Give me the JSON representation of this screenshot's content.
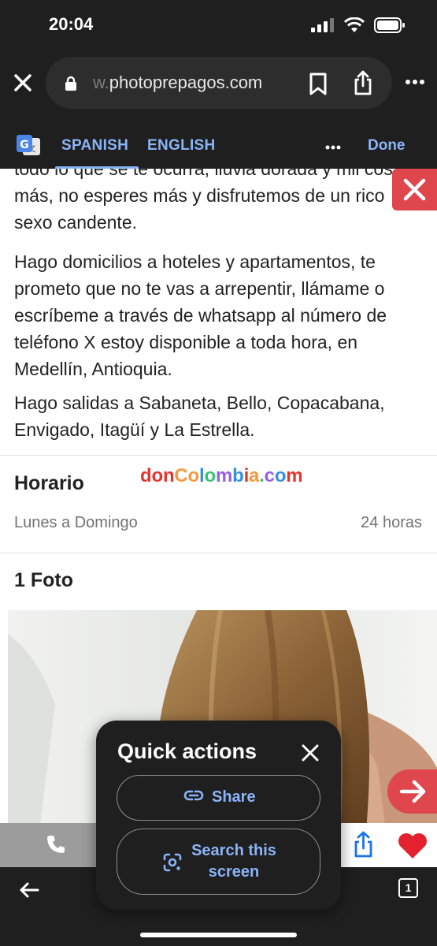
{
  "status_bar": {
    "time": "20:04"
  },
  "browser": {
    "url_prefix": "w.",
    "url_domain": "photoprepagos.com"
  },
  "translate_bar": {
    "languages": [
      "SPANISH",
      "ENGLISH"
    ],
    "active_language": "SPANISH",
    "done_label": "Done"
  },
  "content": {
    "paragraph_1": "todo lo que se te ocurra, lluvia dorada y mil cosas más, no esperes más y disfrutemos de un rico sexo candente.",
    "paragraph_2": "Hago domicilios a hoteles y apartamentos, te prometo que no te vas a arrepentir, llámame o escríbeme a través de whatsapp al número de teléfono X estoy disponible a toda hora, en Medellín, Antioquia.",
    "paragraph_3": "Hago salidas a Sabaneta, Bello, Copacabana, Envigado, Itagüí y La Estrella.",
    "schedule_title": "Horario",
    "watermark": "donColombia.com",
    "schedule_day": "Lunes a Domingo",
    "schedule_hours": "24 horas",
    "photos_title": "1 Foto"
  },
  "quick_actions": {
    "title": "Quick actions",
    "share_label": "Share",
    "search_label": "Search this screen"
  },
  "toolbar": {
    "tab_count": "1"
  },
  "colors": {
    "chrome_dark": "#1f1f1f",
    "link_blue": "#8ab4f8",
    "accent_red": "#e0474c",
    "heart_red": "#e3212f",
    "share_blue": "#1a73e8"
  }
}
